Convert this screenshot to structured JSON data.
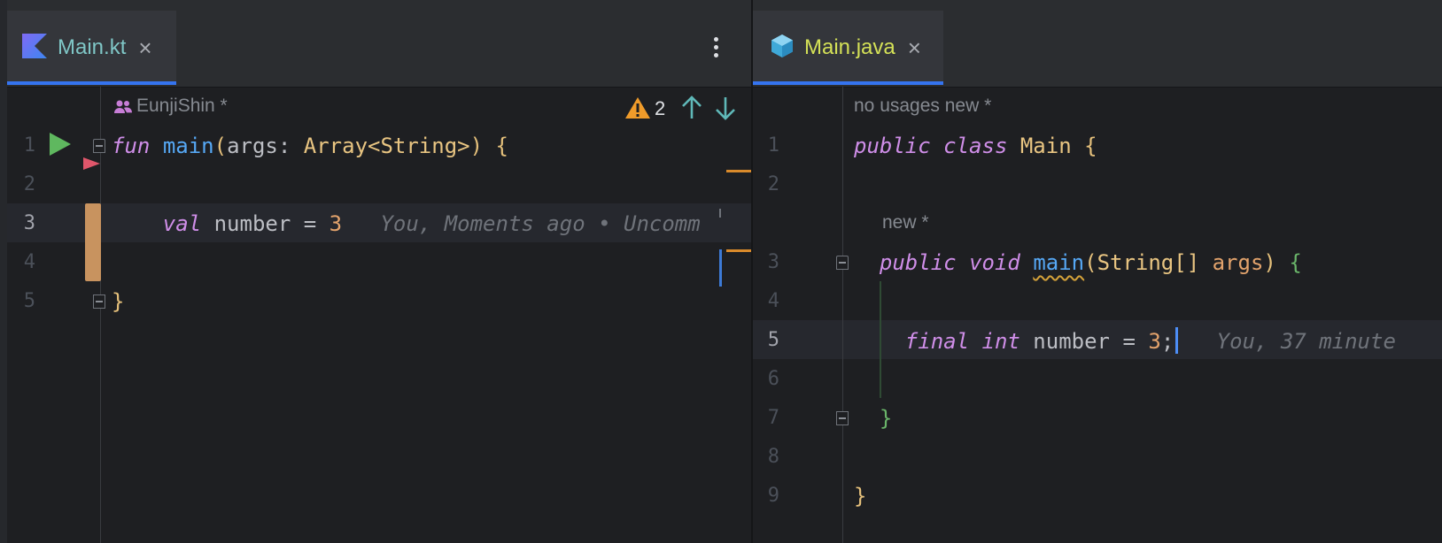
{
  "left_editor": {
    "tab": {
      "label": "Main.kt",
      "close": "×",
      "icon": "kotlin-file-icon",
      "color": "#7fc6c6"
    },
    "toolbar": {
      "author": "EunjiShin *",
      "warning_count": "2",
      "warning_color": "#f09b2a"
    },
    "lines": [
      {
        "num": "1",
        "tokens": [
          {
            "t": "fun",
            "c": "kw"
          },
          {
            "t": " "
          },
          {
            "t": "main",
            "c": "fn"
          },
          {
            "t": "(",
            "c": "brace-y"
          },
          {
            "t": "args: ",
            "c": "param"
          },
          {
            "t": "Array<String>",
            "c": "type"
          },
          {
            "t": ")",
            "c": "brace-y"
          },
          {
            "t": " "
          },
          {
            "t": "{",
            "c": "brace-y"
          }
        ]
      },
      {
        "num": "2",
        "tokens": []
      },
      {
        "num": "3",
        "tokens": [
          {
            "t": "    "
          },
          {
            "t": "val",
            "c": "kw"
          },
          {
            "t": " number = "
          },
          {
            "t": "3",
            "c": "num"
          }
        ],
        "hint": "You, Moments ago • Uncomm"
      },
      {
        "num": "4",
        "tokens": []
      },
      {
        "num": "5",
        "tokens": [
          {
            "t": "}",
            "c": "brace-y"
          }
        ]
      }
    ]
  },
  "right_editor": {
    "tab": {
      "label": "Main.java",
      "close": "×",
      "icon": "java-class-icon",
      "color": "#d4e157"
    },
    "inlays": {
      "line1": "no usages   new *",
      "line3": "new *"
    },
    "lines": [
      {
        "num": "1",
        "tokens": [
          {
            "t": "public",
            "c": "kw"
          },
          {
            "t": " "
          },
          {
            "t": "class",
            "c": "kw"
          },
          {
            "t": " "
          },
          {
            "t": "Main",
            "c": "type"
          },
          {
            "t": " "
          },
          {
            "t": "{",
            "c": "brace-y"
          }
        ]
      },
      {
        "num": "2",
        "tokens": []
      },
      {
        "num": "3",
        "tokens": [
          {
            "t": "  "
          },
          {
            "t": "public",
            "c": "kw"
          },
          {
            "t": " "
          },
          {
            "t": "void",
            "c": "kw"
          },
          {
            "t": " "
          },
          {
            "t": "main",
            "c": "fn squiggle"
          },
          {
            "t": "(",
            "c": "brace-y"
          },
          {
            "t": "String[] ",
            "c": "type"
          },
          {
            "t": "args",
            "c": "num"
          },
          {
            "t": ")",
            "c": "brace-y"
          },
          {
            "t": " "
          },
          {
            "t": "{",
            "c": "brace-g"
          }
        ]
      },
      {
        "num": "4",
        "tokens": []
      },
      {
        "num": "5",
        "tokens": [
          {
            "t": "    "
          },
          {
            "t": "final",
            "c": "kw"
          },
          {
            "t": " "
          },
          {
            "t": "int",
            "c": "kw"
          },
          {
            "t": " number = "
          },
          {
            "t": "3",
            "c": "num"
          },
          {
            "t": ";"
          }
        ],
        "hint": "You, 37 minute"
      },
      {
        "num": "6",
        "tokens": []
      },
      {
        "num": "7",
        "tokens": [
          {
            "t": "  "
          },
          {
            "t": "}",
            "c": "brace-g"
          }
        ]
      },
      {
        "num": "8",
        "tokens": []
      },
      {
        "num": "9",
        "tokens": [
          {
            "t": "}",
            "c": "brace-y"
          }
        ]
      }
    ]
  }
}
